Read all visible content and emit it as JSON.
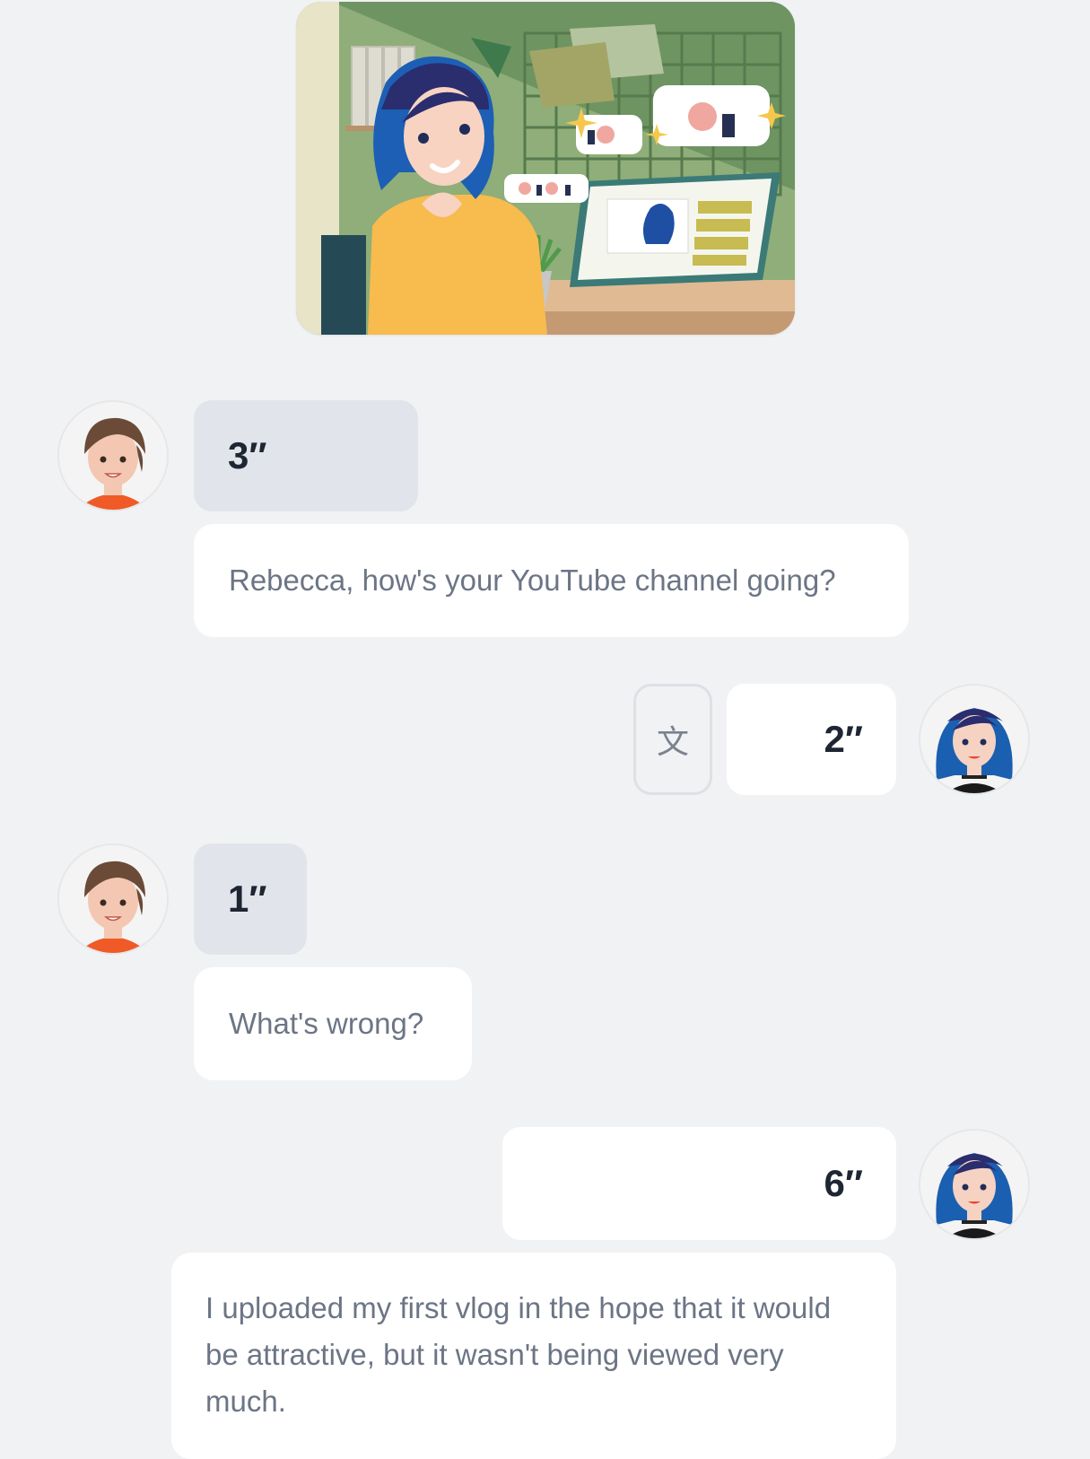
{
  "colors": {
    "page_background": "#f1f2f4",
    "audio_bubble_left": "#e1e5eb",
    "bubble_white": "#ffffff",
    "text_muted": "#6c7585",
    "text_dark": "#1f2633"
  },
  "hero_image": {
    "icon": "vlogger-illustration"
  },
  "messages": [
    {
      "speaker": "left",
      "avatar_icon": "brown-hair-avatar",
      "audio_duration": "3″",
      "text": "Rebecca, how's your YouTube channel going?"
    },
    {
      "speaker": "right",
      "avatar_icon": "blue-hair-avatar",
      "audio_duration": "2″",
      "translate_icon": "文"
    },
    {
      "speaker": "left",
      "avatar_icon": "brown-hair-avatar",
      "audio_duration": "1″",
      "text": "What's wrong?"
    },
    {
      "speaker": "right",
      "avatar_icon": "blue-hair-avatar",
      "audio_duration": "6″",
      "text": "I uploaded my first vlog in the hope that it would be attractive, but it wasn't being viewed very much."
    }
  ]
}
